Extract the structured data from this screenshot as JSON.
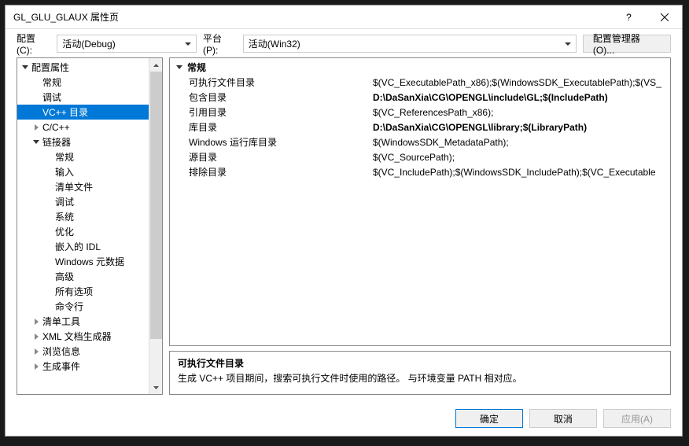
{
  "title": "GL_GLU_GLAUX 属性页",
  "toolbar": {
    "config_label": "配置(C):",
    "config_value": "活动(Debug)",
    "platform_label": "平台(P):",
    "platform_value": "活动(Win32)",
    "manager_btn": "配置管理器(O)..."
  },
  "tree": {
    "root": "配置属性",
    "general": "常规",
    "debug": "调试",
    "vcpp_dirs": "VC++ 目录",
    "cpp": "C/C++",
    "linker": "链接器",
    "linker_children": [
      "常规",
      "输入",
      "清单文件",
      "调试",
      "系统",
      "优化",
      "嵌入的 IDL",
      "Windows 元数据",
      "高级",
      "所有选项",
      "命令行"
    ],
    "manifest_tool": "清单工具",
    "xml_gen": "XML 文档生成器",
    "browse_info": "浏览信息",
    "build_events": "生成事件"
  },
  "props": {
    "group": "常规",
    "rows": [
      {
        "label": "可执行文件目录",
        "value": "$(VC_ExecutablePath_x86);$(WindowsSDK_ExecutablePath);$(VS_",
        "bold": false
      },
      {
        "label": "包含目录",
        "value": "D:\\DaSanXia\\CG\\OPENGL\\include\\GL;$(IncludePath)",
        "bold": true
      },
      {
        "label": "引用目录",
        "value": "$(VC_ReferencesPath_x86);",
        "bold": false
      },
      {
        "label": "库目录",
        "value": "D:\\DaSanXia\\CG\\OPENGL\\library;$(LibraryPath)",
        "bold": true
      },
      {
        "label": "Windows 运行库目录",
        "value": "$(WindowsSDK_MetadataPath);",
        "bold": false
      },
      {
        "label": "源目录",
        "value": "$(VC_SourcePath);",
        "bold": false
      },
      {
        "label": "排除目录",
        "value": "$(VC_IncludePath);$(WindowsSDK_IncludePath);$(VC_Executable",
        "bold": false
      }
    ]
  },
  "desc": {
    "title": "可执行文件目录",
    "body": "生成 VC++ 项目期间，搜索可执行文件时使用的路径。  与环境变量 PATH 相对应。"
  },
  "footer": {
    "ok": "确定",
    "cancel": "取消",
    "apply": "应用(A)"
  }
}
